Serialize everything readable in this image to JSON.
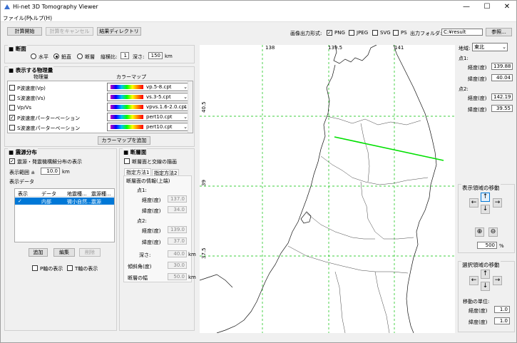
{
  "window": {
    "title": "Hi-net 3D Tomography Viewer",
    "minimize": "—",
    "maximize": "☐",
    "close": "✕"
  },
  "menu": {
    "file": "ファイル(F)",
    "help": "ヘルプ(H)"
  },
  "toolbar": {
    "start": "計算開始",
    "cancel": "計算をキャンセル",
    "results_dir": "結果ディレクトリ",
    "image_format_label": "画像出力形式:",
    "png": "PNG",
    "jpeg": "JPEG",
    "svg": "SVG",
    "ps": "PS",
    "output_folder_label": "出力フォルダ:",
    "output_folder_value": "C:¥result",
    "browse": "参照..."
  },
  "section": {
    "title": "断面",
    "horizontal": "水平",
    "vertical": "鉛直",
    "fault": "断層",
    "aspect_label": "縦横比:",
    "aspect_value": "1",
    "depth_label": "深さ:",
    "depth_value": "150",
    "depth_unit": "km"
  },
  "quantities": {
    "title": "表示する物理量",
    "col_quantity": "物理量",
    "col_cmap": "カラーマップ",
    "rows": [
      {
        "name": "P波速度(Vp)",
        "checked": false,
        "cmap": "vp.5-8.cpt"
      },
      {
        "name": "S波速度(Vs)",
        "checked": false,
        "cmap": "vs.3-5.cpt"
      },
      {
        "name": "Vp/Vs",
        "checked": false,
        "cmap": "vpvs.1.6-2.0.cpt"
      },
      {
        "name": "P波速度パーターベーション",
        "checked": true,
        "cmap": "pert10.cpt"
      },
      {
        "name": "S波速度パーターベーション",
        "checked": false,
        "cmap": "pert10.cpt"
      }
    ],
    "add_cmap": "カラーマップを追加"
  },
  "seismic": {
    "title": "震源分布",
    "show_label": "震源・発震機構解分布の表示",
    "range_label": "表示範囲 ±",
    "range_value": "10.0",
    "range_unit": "km",
    "data_label": "表示データ",
    "columns": [
      "表示",
      "データ",
      "地震種...",
      "震源種..."
    ],
    "rows": [
      {
        "display": "✓",
        "data": "内部",
        "type": "微小自然...",
        "source": "震源"
      }
    ],
    "add": "追加",
    "edit": "編集",
    "delete": "削除",
    "p_axis": "P軸の表示",
    "t_axis": "T軸の表示"
  },
  "fault": {
    "title": "断層面",
    "draw_label": "断層面と交線の描画",
    "tab1": "指定方法1",
    "tab2": "指定方法2",
    "info_label": "断層面の情報(上端)",
    "p1": "点1:",
    "p2": "点2:",
    "lon_label": "経度(度)",
    "lat_label": "緯度(度)",
    "p1_lon": "137.0",
    "p1_lat": "34.0",
    "p2_lon": "139.0",
    "p2_lat": "37.0",
    "depth_label": "深さ:",
    "depth_value": "40.0",
    "depth_unit": "km",
    "dip_label": "傾斜角(度)",
    "dip_value": "30.0",
    "width_label": "断層の幅",
    "width_value": "50.0",
    "width_unit": "km"
  },
  "map": {
    "lon_ticks": [
      "138",
      "139.5",
      "141"
    ],
    "lat_ticks": [
      "40.5",
      "39",
      "37.5"
    ]
  },
  "sidebar": {
    "region_label": "地域:",
    "region_value": "東北",
    "p1": "点1:",
    "p2": "点2:",
    "lon_label": "経度(度)",
    "lat_label": "緯度(度)",
    "p1_lon": "139.88",
    "p1_lat": "40.04",
    "p2_lon": "142.19",
    "p2_lat": "39.55",
    "pan_title": "表示領域の移動",
    "zoom_value": "500",
    "zoom_unit": "%",
    "sel_title": "選択領域の移動",
    "step_label": "移動の単位:",
    "step_lon": "1.0",
    "step_lat": "1.0"
  },
  "colors": {
    "selection": "#0078d7",
    "section_line": "#00e000",
    "grid": "#00c000"
  }
}
